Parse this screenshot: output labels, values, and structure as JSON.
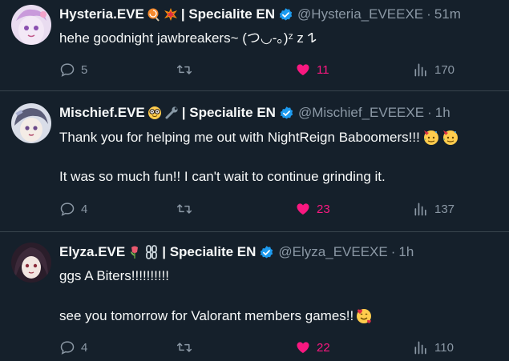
{
  "tweets": [
    {
      "display_name": "Hysteria.EVE",
      "emojis": [
        "lollipop-emoji",
        "collision-emoji"
      ],
      "affiliation": "| Specialite EN",
      "handle": "@Hysteria_EVEEXE",
      "separator": "·",
      "time": "51m",
      "lines": [
        "hehe goodnight jawbreakers~ (つ◡-。)ᶻ z 𐰁"
      ],
      "reply_count": "5",
      "retweet_count": "",
      "like_count": "11",
      "liked": true,
      "view_count": "170"
    },
    {
      "display_name": "Mischief.EVE",
      "emojis": [
        "nerd-face-emoji",
        "wrench-emoji"
      ],
      "affiliation": "| Specialite EN",
      "handle": "@Mischief_EVEEXE",
      "separator": "·",
      "time": "1h",
      "lines": [
        "Thank you for helping me out with NightReign Baboomers!!!",
        "It was so much fun!! I can't wait to continue grinding it."
      ],
      "reply_count": "4",
      "retweet_count": "",
      "like_count": "23",
      "liked": true,
      "view_count": "137"
    },
    {
      "display_name": "Elyza.EVE",
      "emojis": [
        "tulip-emoji",
        "chains-emoji"
      ],
      "affiliation": "| Specialite EN",
      "handle": "@Elyza_EVEEXE",
      "separator": "·",
      "time": "1h",
      "lines": [
        "ggs A Biters!!!!!!!!!!",
        "see you tomorrow for Valorant members games!!"
      ],
      "reply_count": "4",
      "retweet_count": "",
      "like_count": "22",
      "liked": true,
      "view_count": "110"
    }
  ],
  "colors": {
    "background": "#15202b",
    "text": "#f7f9f9",
    "muted": "#8b98a5",
    "like": "#f91880",
    "verified": "#1d9bf0",
    "divider": "#38444d"
  }
}
